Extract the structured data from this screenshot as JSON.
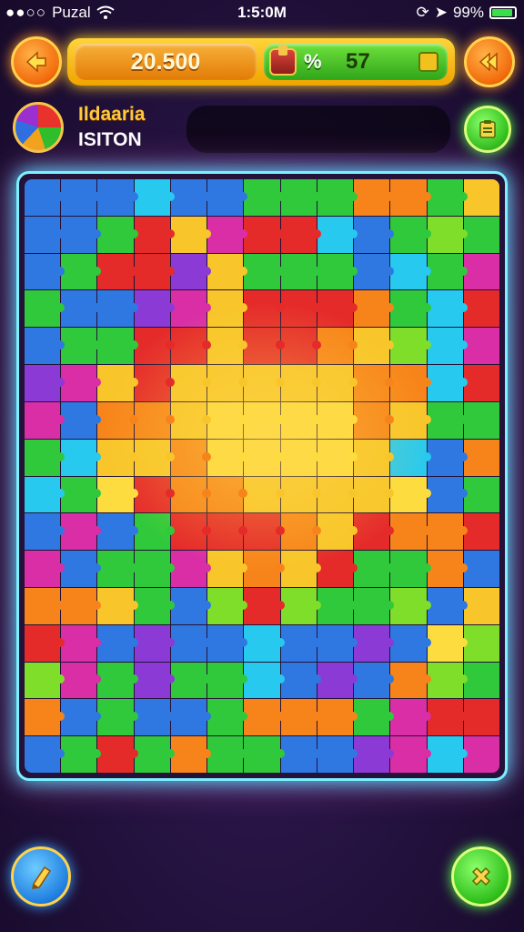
{
  "status_bar": {
    "carrier": "Puzal",
    "time": "1:5:0M",
    "battery": "99%"
  },
  "header": {
    "score": "20.500",
    "percent_symbol": "%",
    "count": "57"
  },
  "player": {
    "name": "Ildaaria",
    "score": "ISITON"
  },
  "icons": {
    "back": "arrow-left-icon",
    "fast_forward": "rewind-icon",
    "chest": "treasure-chest-icon",
    "badge": "coin-badge-icon",
    "menu": "clipboard-icon",
    "hint": "pencil-icon",
    "close": "close-icon"
  },
  "colors": {
    "red": "#e52a2a",
    "orange": "#f7841a",
    "yellow": "#f8c62a",
    "lightyellow": "#fddc3f",
    "green": "#2fc93b",
    "lime": "#7ede2a",
    "blue": "#2f78e2",
    "cyan": "#28c9ef",
    "purple": "#8b3ad6",
    "magenta": "#d92ea6"
  },
  "board": {
    "columns": 13,
    "rows": [
      [
        "blue",
        "blue",
        "blue",
        "cyan",
        "blue",
        "blue",
        "green",
        "green",
        "green",
        "orange",
        "orange",
        "green",
        "yellow"
      ],
      [
        "blue",
        "blue",
        "green",
        "red",
        "yellow",
        "magenta",
        "red",
        "red",
        "cyan",
        "blue",
        "green",
        "lime",
        "green"
      ],
      [
        "blue",
        "green",
        "red",
        "red",
        "purple",
        "yellow",
        "green",
        "green",
        "green",
        "blue",
        "cyan",
        "green",
        "magenta"
      ],
      [
        "green",
        "blue",
        "blue",
        "purple",
        "magenta",
        "yellow",
        "red",
        "red",
        "red",
        "orange",
        "green",
        "cyan",
        "red"
      ],
      [
        "blue",
        "green",
        "green",
        "red",
        "red",
        "yellow",
        "red",
        "red",
        "orange",
        "yellow",
        "lime",
        "cyan",
        "magenta"
      ],
      [
        "purple",
        "magenta",
        "yellow",
        "red",
        "yellow",
        "yellow",
        "yellow",
        "yellow",
        "yellow",
        "orange",
        "orange",
        "cyan",
        "red"
      ],
      [
        "magenta",
        "blue",
        "orange",
        "orange",
        "yellow",
        "lightyellow",
        "lightyellow",
        "lightyellow",
        "lightyellow",
        "orange",
        "yellow",
        "green",
        "green"
      ],
      [
        "green",
        "cyan",
        "yellow",
        "yellow",
        "orange",
        "lightyellow",
        "lightyellow",
        "lightyellow",
        "lightyellow",
        "yellow",
        "cyan",
        "blue",
        "orange"
      ],
      [
        "cyan",
        "green",
        "lightyellow",
        "red",
        "orange",
        "orange",
        "yellow",
        "yellow",
        "yellow",
        "yellow",
        "lightyellow",
        "blue",
        "green"
      ],
      [
        "blue",
        "magenta",
        "blue",
        "green",
        "red",
        "red",
        "red",
        "orange",
        "yellow",
        "red",
        "orange",
        "orange",
        "red"
      ],
      [
        "magenta",
        "blue",
        "green",
        "green",
        "magenta",
        "yellow",
        "orange",
        "yellow",
        "red",
        "green",
        "green",
        "orange",
        "blue"
      ],
      [
        "orange",
        "orange",
        "yellow",
        "green",
        "blue",
        "lime",
        "red",
        "lime",
        "green",
        "green",
        "lime",
        "blue",
        "yellow"
      ],
      [
        "red",
        "magenta",
        "blue",
        "purple",
        "blue",
        "blue",
        "cyan",
        "blue",
        "blue",
        "purple",
        "blue",
        "lightyellow",
        "lime"
      ],
      [
        "lime",
        "magenta",
        "green",
        "purple",
        "green",
        "green",
        "cyan",
        "blue",
        "purple",
        "blue",
        "orange",
        "lime",
        "green"
      ],
      [
        "orange",
        "blue",
        "green",
        "blue",
        "blue",
        "green",
        "orange",
        "orange",
        "orange",
        "green",
        "magenta",
        "red",
        "red"
      ],
      [
        "blue",
        "green",
        "red",
        "green",
        "orange",
        "green",
        "green",
        "blue",
        "blue",
        "purple",
        "magenta",
        "cyan",
        "magenta"
      ]
    ]
  }
}
